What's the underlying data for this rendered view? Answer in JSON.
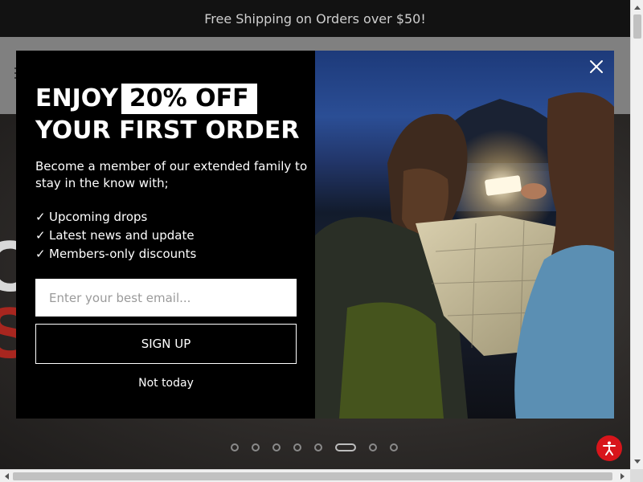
{
  "announcement": {
    "text": "Free Shipping on Orders over $50!"
  },
  "popup": {
    "headline_prefix": "ENJOY",
    "headline_highlight": "20% OFF",
    "headline_line2": "YOUR FIRST ORDER",
    "intro": "Become a member of our extended family to stay in the know with;",
    "perks": [
      {
        "check": "✓",
        "label": "Upcoming drops"
      },
      {
        "check": "✓",
        "label": "Latest news and update"
      },
      {
        "check": "✓",
        "label": "Members-only discounts"
      }
    ],
    "email": {
      "value": "",
      "placeholder": "Enter your best email..."
    },
    "signup_label": "SIGN UP",
    "decline_label": "Not today",
    "close_icon": "close-icon",
    "image_icon": "camping-map-lantern-photo"
  },
  "hero": {
    "partial_text_white": "C",
    "partial_text_red": "S",
    "slider": {
      "total_slides": 8,
      "active_index": 6
    }
  },
  "colors": {
    "accent_red": "#a8261f",
    "accessibility_red": "#d8151b",
    "modal_bg": "#000000",
    "announce_bg": "#121212"
  },
  "accessibility": {
    "icon": "accessibility-icon"
  }
}
